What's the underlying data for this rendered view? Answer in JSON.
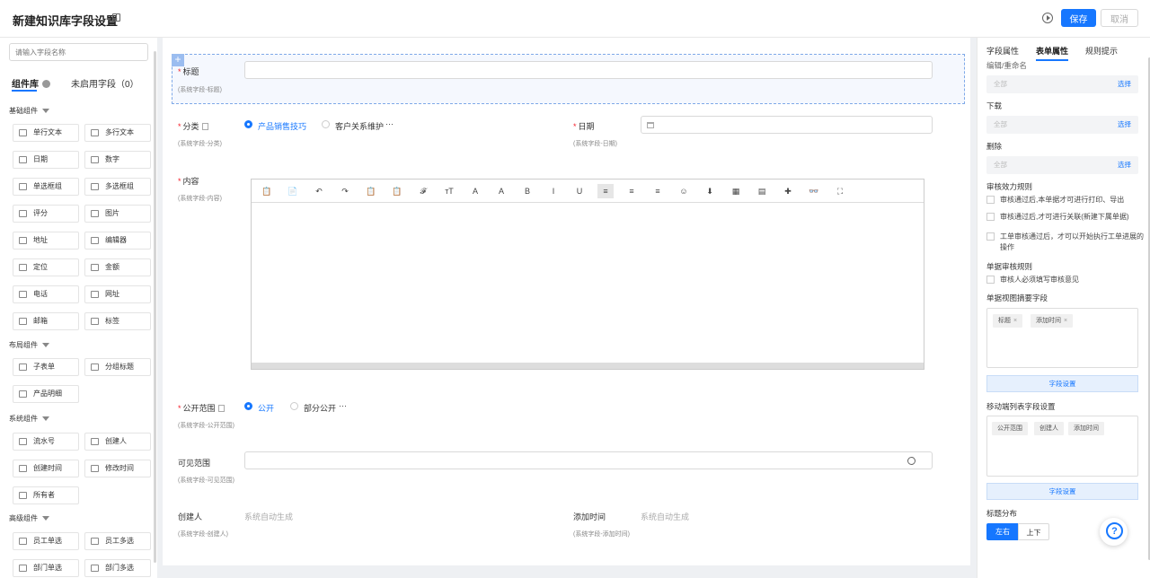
{
  "header": {
    "title": "新建知识库字段设置",
    "save": "保存",
    "cancel": "取消"
  },
  "left": {
    "search_placeholder": "请输入字段名称",
    "tab_library": "组件库",
    "tab_disabled": "未启用字段（0）",
    "groups": {
      "basic": "基础组件",
      "layout": "布局组件",
      "system": "系统组件",
      "advanced": "高级组件"
    },
    "basic_items": [
      "单行文本",
      "多行文本",
      "日期",
      "数字",
      "单选框组",
      "多选框组",
      "评分",
      "图片",
      "地址",
      "编辑器",
      "定位",
      "金额",
      "电话",
      "网址",
      "邮箱",
      "标签"
    ],
    "layout_items": [
      "子表单",
      "分组标题",
      "产品明细"
    ],
    "system_items": [
      "流水号",
      "创建人",
      "创建时间",
      "修改时间",
      "所有者"
    ],
    "advanced_items": [
      "员工单选",
      "员工多选",
      "部门单选",
      "部门多选"
    ]
  },
  "form": {
    "title": {
      "label": "标题",
      "sub": "(系统字段-标题)"
    },
    "category": {
      "label": "分类",
      "sub": "(系统字段-分类)",
      "opt1": "产品销售技巧",
      "opt2": "客户关系维护",
      "more": "···"
    },
    "date": {
      "label": "日期",
      "sub": "(系统字段-日期)"
    },
    "content": {
      "label": "内容",
      "sub": "(系统字段-内容)"
    },
    "toolbar": [
      "📋",
      "📄",
      "↶",
      "↷",
      "📋",
      "📋",
      "𝓕",
      "ᴛT",
      "A",
      "A",
      "B",
      "I",
      "U",
      "≡",
      "≡",
      "≡",
      "☺",
      "⬇",
      "▦",
      "▤",
      "✚",
      "👓",
      "⛶"
    ],
    "public": {
      "label": "公开范围",
      "sub": "(系统字段-公开范围)",
      "opt1": "公开",
      "opt2": "部分公开",
      "more": "···"
    },
    "visible": {
      "label": "可见范围",
      "sub": "(系统字段-可见范围)"
    },
    "creator": {
      "label": "创建人",
      "sub": "(系统字段-创建人)",
      "value": "系统自动生成"
    },
    "addtime": {
      "label": "添加时间",
      "sub": "(系统字段-添加时间)",
      "value": "系统自动生成"
    }
  },
  "right": {
    "tabs": [
      "字段属性",
      "表单属性",
      "规则提示"
    ],
    "edit_label": "编辑/重命名",
    "all": "全部",
    "pick": "选择",
    "download": "下载",
    "delete": "删除",
    "audit_rule": "审核效力规则",
    "audit_opts": [
      "审核通过后,本单据才可进行打印、导出",
      "审核通过后,才可进行关联(新建下属单据)",
      "工单审核通过后，才可以开始执行工单进展的操作"
    ],
    "doc_audit_rule": "单据审核规则",
    "doc_audit_opt": "审核人必须填写审核意见",
    "summary_label": "单据视图摘要字段",
    "summary_tags": [
      "标题",
      "添加时间"
    ],
    "field_setting": "字段设置",
    "mobile_label": "移动端列表字段设置",
    "mobile_tags": [
      "公开范围",
      "创建人",
      "添加时间"
    ],
    "title_layout": "标题分布",
    "layout_left": "左右",
    "layout_top": "上下"
  }
}
